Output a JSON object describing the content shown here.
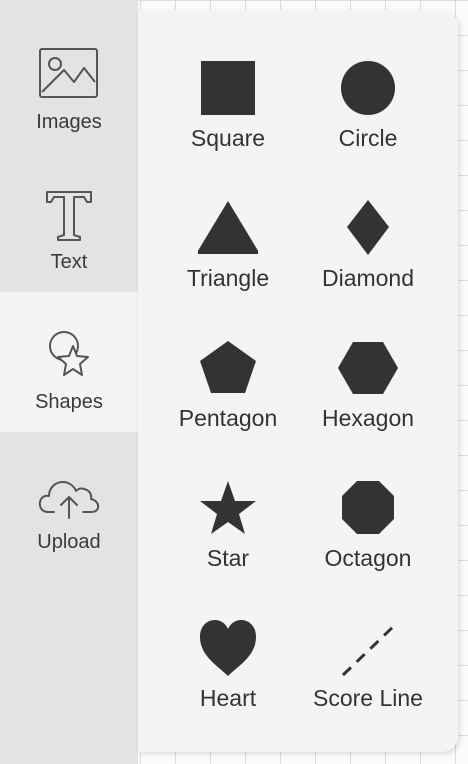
{
  "sidebar": {
    "tabs": [
      {
        "label": "Images",
        "icon": "image-icon"
      },
      {
        "label": "Text",
        "icon": "text-icon"
      },
      {
        "label": "Shapes",
        "icon": "shapes-icon",
        "active": true
      },
      {
        "label": "Upload",
        "icon": "cloud-upload-icon"
      }
    ]
  },
  "shapes": {
    "items": [
      {
        "label": "Square",
        "icon": "square-icon"
      },
      {
        "label": "Circle",
        "icon": "circle-icon"
      },
      {
        "label": "Triangle",
        "icon": "triangle-icon"
      },
      {
        "label": "Diamond",
        "icon": "diamond-icon"
      },
      {
        "label": "Pentagon",
        "icon": "pentagon-icon"
      },
      {
        "label": "Hexagon",
        "icon": "hexagon-icon"
      },
      {
        "label": "Star",
        "icon": "star-icon"
      },
      {
        "label": "Octagon",
        "icon": "octagon-icon"
      },
      {
        "label": "Heart",
        "icon": "heart-icon"
      },
      {
        "label": "Score Line",
        "icon": "score-line-icon"
      }
    ]
  },
  "colors": {
    "shape_fill": "#333333",
    "sidebar_bg": "#e3e3e5",
    "panel_bg": "#f3f4f5"
  }
}
